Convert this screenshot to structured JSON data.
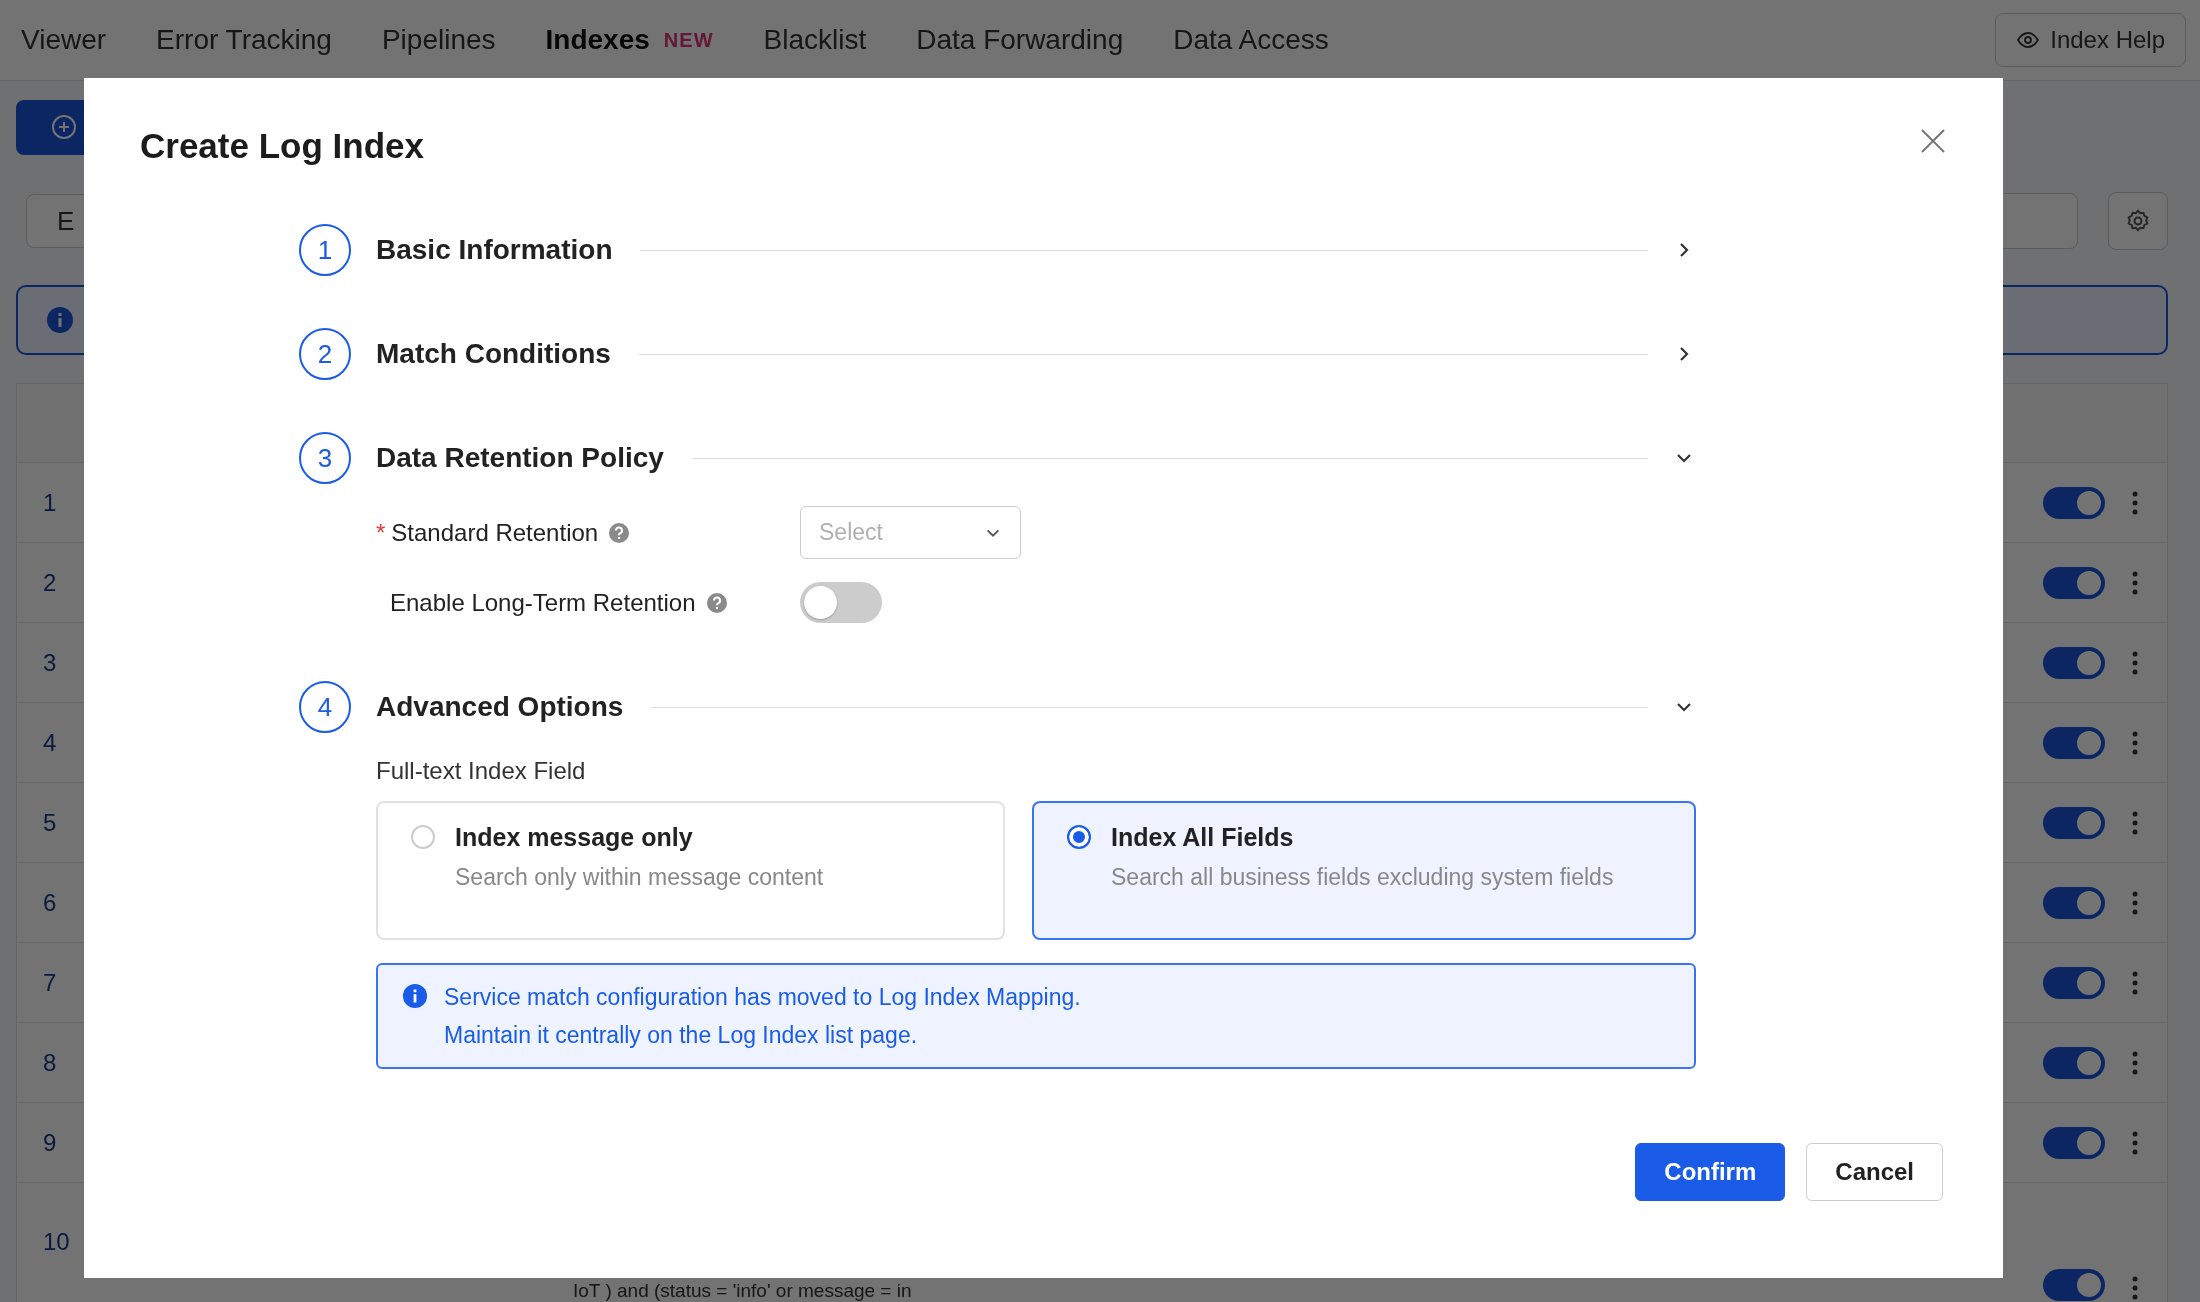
{
  "nav": {
    "tabs": [
      {
        "label": "Viewer",
        "selected": false
      },
      {
        "label": "Error Tracking",
        "selected": false
      },
      {
        "label": "Pipelines",
        "selected": false
      },
      {
        "label": "Indexes",
        "selected": true,
        "badge": "NEW"
      },
      {
        "label": "Blacklist",
        "selected": false
      },
      {
        "label": "Data Forwarding",
        "selected": false
      },
      {
        "label": "Data Access",
        "selected": false
      }
    ],
    "help_button": "Index Help"
  },
  "background": {
    "filter_fragment": "E",
    "rows": [
      {
        "index": "1",
        "on": true
      },
      {
        "index": "2",
        "on": true
      },
      {
        "index": "3",
        "on": true
      },
      {
        "index": "4",
        "on": true
      },
      {
        "index": "5",
        "on": true
      },
      {
        "index": "6",
        "on": true
      },
      {
        "index": "7",
        "on": true
      },
      {
        "index": "8",
        "on": true
      },
      {
        "index": "9",
        "on": true
      },
      {
        "index": "10",
        "on": true
      }
    ],
    "query_text": "IoT ) and (status = 'info' or message = in"
  },
  "dialog": {
    "title": "Create Log Index",
    "steps": [
      {
        "number": "1",
        "title": "Basic Information",
        "expanded": false
      },
      {
        "number": "2",
        "title": "Match Conditions",
        "expanded": false
      },
      {
        "number": "3",
        "title": "Data Retention Policy",
        "expanded": true
      },
      {
        "number": "4",
        "title": "Advanced Options",
        "expanded": true
      }
    ],
    "retention": {
      "standard": {
        "label": "Standard Retention",
        "required_mark": "*",
        "placeholder": "Select"
      },
      "long_term": {
        "label": "Enable Long-Term Retention",
        "on": false
      }
    },
    "advanced": {
      "label": "Full-text Index Field",
      "options": [
        {
          "title": "Index message only",
          "description": "Search only within message content",
          "selected": false
        },
        {
          "title": "Index All Fields",
          "description": "Search all business fields excluding system fields",
          "selected": true
        }
      ],
      "notice": [
        "Service match configuration has moved to Log Index Mapping.",
        "Maintain it centrally on the Log Index list page."
      ]
    },
    "buttons": [
      {
        "label": "Confirm",
        "kind": "primary"
      },
      {
        "label": "Cancel",
        "kind": "secondary"
      }
    ]
  }
}
